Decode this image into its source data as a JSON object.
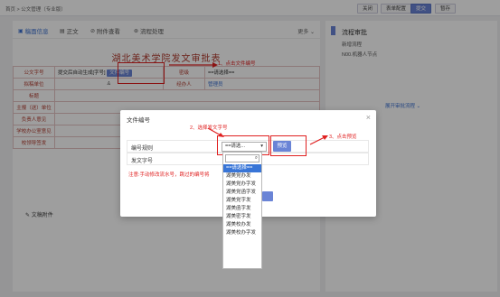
{
  "breadcrumb": "首页 > 公文管理（专业版）",
  "top_buttons": [
    "关闭",
    "表单配置",
    "提交",
    "暂存"
  ],
  "tabs": [
    {
      "label": "稿面信息",
      "icon": "form-icon"
    },
    {
      "label": "正文",
      "icon": "document-icon"
    },
    {
      "label": "附件查看",
      "icon": "attachment-icon"
    },
    {
      "label": "流程处理",
      "icon": "flow-icon"
    }
  ],
  "more_label": "更多",
  "form_title": "湖北美术学院发文审批表",
  "form": {
    "row1": {
      "label": "公文字号",
      "value": "提交后自动生成[字号]",
      "button": "文件编号",
      "label2": "密级",
      "value2": "==请选择== "
    },
    "row2": {
      "label": "拟稿单位",
      "value": "",
      "label2": "经办人",
      "value2": "管理员"
    },
    "row3": {
      "label": "标题"
    },
    "row4": {
      "label": "主报（送）单位"
    },
    "row5": {
      "label": "负责人意见"
    },
    "row6": {
      "label": "学校办公室意见"
    },
    "row7": {
      "label": "校领导签发"
    }
  },
  "attachments_label": "文稿附件",
  "annotation_1": "1、点击文件编号",
  "annotation_2": "2、选择发文字号",
  "annotation_3": "3、点击预览",
  "dialog": {
    "title": "文件编号",
    "rule_label": "编号规则",
    "rule_select": "==请选...",
    "preview_button": "预览",
    "number_label": "发文字号",
    "note": "注意:手动修改流水号，跳过的编号将",
    "options": [
      "==请选择==",
      "湖美党办发",
      "湖美党办字发",
      "湖美党函字发",
      "湖美党字发",
      "湖美函字发",
      "湖美密字发",
      "湖美校办发",
      "湖美校办字发"
    ]
  },
  "right_panel": {
    "title": "流程审批",
    "line1": "新增流程",
    "line2": "N00.机器人节点",
    "link": "展开审批流程"
  }
}
